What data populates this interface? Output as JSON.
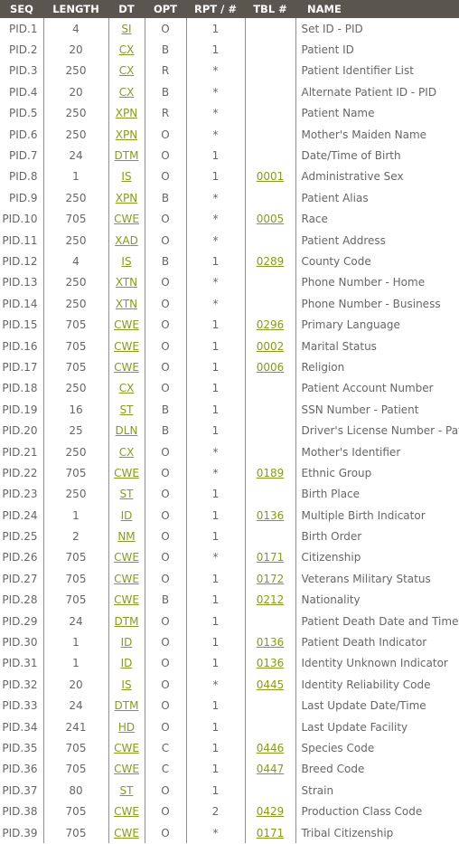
{
  "headers": [
    "SEQ",
    "LENGTH",
    "DT",
    "OPT",
    "RPT / #",
    "TBL #",
    "NAME"
  ],
  "link_color": "#8a9a1a",
  "header_bg": "#5b554f",
  "rows": [
    {
      "seq": "PID.1",
      "length": "4",
      "dt": "SI",
      "opt": "O",
      "rpt": "1",
      "tbl": "",
      "name": "Set ID - PID"
    },
    {
      "seq": "PID.2",
      "length": "20",
      "dt": "CX",
      "opt": "B",
      "rpt": "1",
      "tbl": "",
      "name": "Patient ID"
    },
    {
      "seq": "PID.3",
      "length": "250",
      "dt": "CX",
      "opt": "R",
      "rpt": "*",
      "tbl": "",
      "name": "Patient Identifier List"
    },
    {
      "seq": "PID.4",
      "length": "20",
      "dt": "CX",
      "opt": "B",
      "rpt": "*",
      "tbl": "",
      "name": "Alternate Patient ID - PID"
    },
    {
      "seq": "PID.5",
      "length": "250",
      "dt": "XPN",
      "opt": "R",
      "rpt": "*",
      "tbl": "",
      "name": "Patient Name"
    },
    {
      "seq": "PID.6",
      "length": "250",
      "dt": "XPN",
      "opt": "O",
      "rpt": "*",
      "tbl": "",
      "name": "Mother's Maiden Name"
    },
    {
      "seq": "PID.7",
      "length": "24",
      "dt": "DTM",
      "opt": "O",
      "rpt": "1",
      "tbl": "",
      "name": "Date/Time of Birth"
    },
    {
      "seq": "PID.8",
      "length": "1",
      "dt": "IS",
      "opt": "O",
      "rpt": "1",
      "tbl": "0001",
      "name": "Administrative Sex"
    },
    {
      "seq": "PID.9",
      "length": "250",
      "dt": "XPN",
      "opt": "B",
      "rpt": "*",
      "tbl": "",
      "name": "Patient Alias"
    },
    {
      "seq": "PID.10",
      "length": "705",
      "dt": "CWE",
      "opt": "O",
      "rpt": "*",
      "tbl": "0005",
      "name": "Race"
    },
    {
      "seq": "PID.11",
      "length": "250",
      "dt": "XAD",
      "opt": "O",
      "rpt": "*",
      "tbl": "",
      "name": "Patient Address"
    },
    {
      "seq": "PID.12",
      "length": "4",
      "dt": "IS",
      "opt": "B",
      "rpt": "1",
      "tbl": "0289",
      "name": "County Code"
    },
    {
      "seq": "PID.13",
      "length": "250",
      "dt": "XTN",
      "opt": "O",
      "rpt": "*",
      "tbl": "",
      "name": "Phone Number - Home"
    },
    {
      "seq": "PID.14",
      "length": "250",
      "dt": "XTN",
      "opt": "O",
      "rpt": "*",
      "tbl": "",
      "name": "Phone Number - Business"
    },
    {
      "seq": "PID.15",
      "length": "705",
      "dt": "CWE",
      "opt": "O",
      "rpt": "1",
      "tbl": "0296",
      "name": "Primary Language"
    },
    {
      "seq": "PID.16",
      "length": "705",
      "dt": "CWE",
      "opt": "O",
      "rpt": "1",
      "tbl": "0002",
      "name": "Marital Status"
    },
    {
      "seq": "PID.17",
      "length": "705",
      "dt": "CWE",
      "opt": "O",
      "rpt": "1",
      "tbl": "0006",
      "name": "Religion"
    },
    {
      "seq": "PID.18",
      "length": "250",
      "dt": "CX",
      "opt": "O",
      "rpt": "1",
      "tbl": "",
      "name": "Patient Account Number"
    },
    {
      "seq": "PID.19",
      "length": "16",
      "dt": "ST",
      "opt": "B",
      "rpt": "1",
      "tbl": "",
      "name": "SSN Number - Patient"
    },
    {
      "seq": "PID.20",
      "length": "25",
      "dt": "DLN",
      "opt": "B",
      "rpt": "1",
      "tbl": "",
      "name": "Driver's License Number - Patient"
    },
    {
      "seq": "PID.21",
      "length": "250",
      "dt": "CX",
      "opt": "O",
      "rpt": "*",
      "tbl": "",
      "name": "Mother's Identifier"
    },
    {
      "seq": "PID.22",
      "length": "705",
      "dt": "CWE",
      "opt": "O",
      "rpt": "*",
      "tbl": "0189",
      "name": "Ethnic Group"
    },
    {
      "seq": "PID.23",
      "length": "250",
      "dt": "ST",
      "opt": "O",
      "rpt": "1",
      "tbl": "",
      "name": "Birth Place"
    },
    {
      "seq": "PID.24",
      "length": "1",
      "dt": "ID",
      "opt": "O",
      "rpt": "1",
      "tbl": "0136",
      "name": "Multiple Birth Indicator"
    },
    {
      "seq": "PID.25",
      "length": "2",
      "dt": "NM",
      "opt": "O",
      "rpt": "1",
      "tbl": "",
      "name": "Birth Order"
    },
    {
      "seq": "PID.26",
      "length": "705",
      "dt": "CWE",
      "opt": "O",
      "rpt": "*",
      "tbl": "0171",
      "name": "Citizenship"
    },
    {
      "seq": "PID.27",
      "length": "705",
      "dt": "CWE",
      "opt": "O",
      "rpt": "1",
      "tbl": "0172",
      "name": "Veterans Military Status"
    },
    {
      "seq": "PID.28",
      "length": "705",
      "dt": "CWE",
      "opt": "B",
      "rpt": "1",
      "tbl": "0212",
      "name": "Nationality"
    },
    {
      "seq": "PID.29",
      "length": "24",
      "dt": "DTM",
      "opt": "O",
      "rpt": "1",
      "tbl": "",
      "name": "Patient Death Date and Time"
    },
    {
      "seq": "PID.30",
      "length": "1",
      "dt": "ID",
      "opt": "O",
      "rpt": "1",
      "tbl": "0136",
      "name": "Patient Death Indicator"
    },
    {
      "seq": "PID.31",
      "length": "1",
      "dt": "ID",
      "opt": "O",
      "rpt": "1",
      "tbl": "0136",
      "name": "Identity Unknown Indicator"
    },
    {
      "seq": "PID.32",
      "length": "20",
      "dt": "IS",
      "opt": "O",
      "rpt": "*",
      "tbl": "0445",
      "name": "Identity Reliability Code"
    },
    {
      "seq": "PID.33",
      "length": "24",
      "dt": "DTM",
      "opt": "O",
      "rpt": "1",
      "tbl": "",
      "name": "Last Update Date/Time"
    },
    {
      "seq": "PID.34",
      "length": "241",
      "dt": "HD",
      "opt": "O",
      "rpt": "1",
      "tbl": "",
      "name": "Last Update Facility"
    },
    {
      "seq": "PID.35",
      "length": "705",
      "dt": "CWE",
      "opt": "C",
      "rpt": "1",
      "tbl": "0446",
      "name": "Species Code"
    },
    {
      "seq": "PID.36",
      "length": "705",
      "dt": "CWE",
      "opt": "C",
      "rpt": "1",
      "tbl": "0447",
      "name": "Breed Code"
    },
    {
      "seq": "PID.37",
      "length": "80",
      "dt": "ST",
      "opt": "O",
      "rpt": "1",
      "tbl": "",
      "name": "Strain"
    },
    {
      "seq": "PID.38",
      "length": "705",
      "dt": "CWE",
      "opt": "O",
      "rpt": "2",
      "tbl": "0429",
      "name": "Production Class Code"
    },
    {
      "seq": "PID.39",
      "length": "705",
      "dt": "CWE",
      "opt": "O",
      "rpt": "*",
      "tbl": "0171",
      "name": "Tribal Citizenship"
    }
  ]
}
